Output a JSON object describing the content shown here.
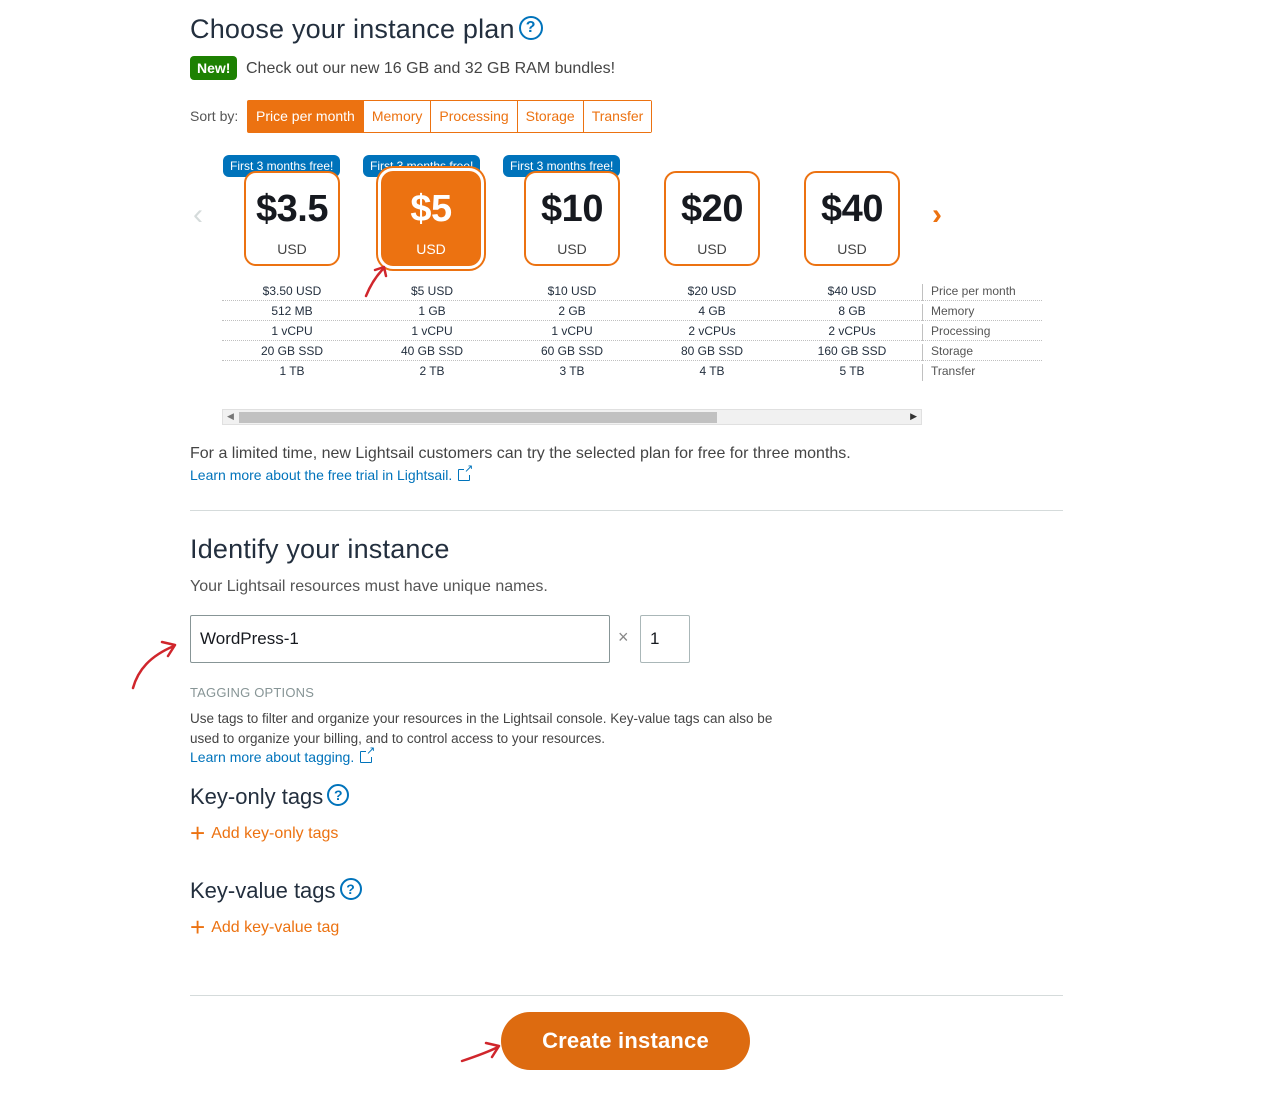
{
  "plan_section": {
    "title": "Choose your instance plan",
    "help": "?",
    "new_badge": "New!",
    "new_text": "Check out our new 16 GB and 32 GB RAM bundles!",
    "sort_label": "Sort by:",
    "sort_options": [
      "Price per month",
      "Memory",
      "Processing",
      "Storage",
      "Transfer"
    ],
    "sort_active": "Price per month",
    "free_badge": "First 3 months free!",
    "plans": [
      {
        "price": "$3.5",
        "currency": "USD",
        "specs": [
          "$3.50 USD",
          "512 MB",
          "1 vCPU",
          "20 GB SSD",
          "1 TB"
        ],
        "free": true,
        "selected": false
      },
      {
        "price": "$5",
        "currency": "USD",
        "specs": [
          "$5 USD",
          "1 GB",
          "1 vCPU",
          "40 GB SSD",
          "2 TB"
        ],
        "free": true,
        "selected": true
      },
      {
        "price": "$10",
        "currency": "USD",
        "specs": [
          "$10 USD",
          "2 GB",
          "1 vCPU",
          "60 GB SSD",
          "3 TB"
        ],
        "free": true,
        "selected": false
      },
      {
        "price": "$20",
        "currency": "USD",
        "specs": [
          "$20 USD",
          "4 GB",
          "2 vCPUs",
          "80 GB SSD",
          "4 TB"
        ],
        "free": false,
        "selected": false
      },
      {
        "price": "$40",
        "currency": "USD",
        "specs": [
          "$40 USD",
          "8 GB",
          "2 vCPUs",
          "160 GB SSD",
          "5 TB"
        ],
        "free": false,
        "selected": false
      }
    ],
    "spec_labels": [
      "Price per month",
      "Memory",
      "Processing",
      "Storage",
      "Transfer"
    ],
    "nav_prev": "‹",
    "nav_next": "›",
    "trial_text": "For a limited time, new Lightsail customers can try the selected plan for free for three months.",
    "trial_link": "Learn more about the free trial in Lightsail."
  },
  "identify_section": {
    "title": "Identify your instance",
    "subtitle": "Your Lightsail resources must have unique names.",
    "name_value": "WordPress-1",
    "times": "×",
    "count_value": "1",
    "tagging_heading": "TAGGING OPTIONS",
    "tagging_desc": "Use tags to filter and organize your resources in the Lightsail console. Key-value tags can also be used to organize your billing, and to control access to your resources.",
    "tagging_link": "Learn more about tagging.",
    "key_only_title": "Key-only tags",
    "key_only_add": "Add key-only tags",
    "key_value_title": "Key-value tags",
    "key_value_add": "Add key-value tag"
  },
  "footer": {
    "create_label": "Create instance"
  },
  "colors": {
    "accent": "#ec7211",
    "link": "#0073bb",
    "new_badge": "#1d8102",
    "annotation": "#d0262c"
  }
}
